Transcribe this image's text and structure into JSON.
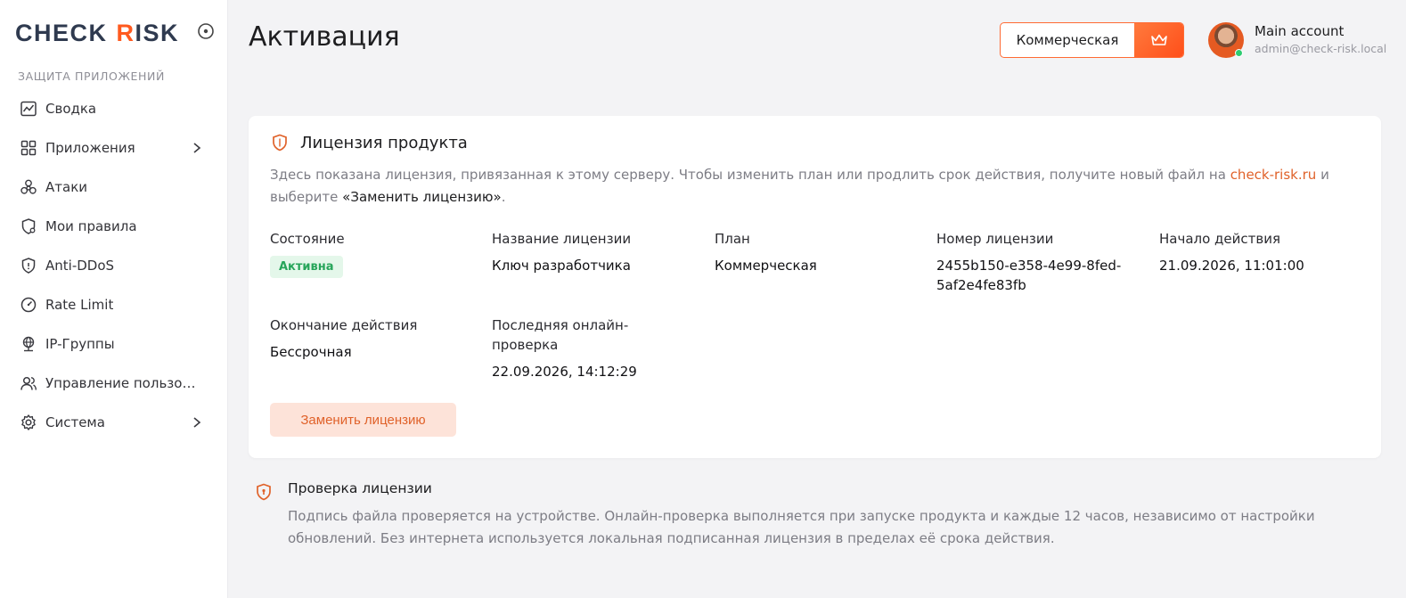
{
  "brand": {
    "part1": "CHECK",
    "letter_k": "R",
    "part2": "ISK",
    "accent": "#ff5a1f",
    "dark": "#2f3a4f"
  },
  "sidebar": {
    "section_title": "ЗАЩИТА ПРИЛОЖЕНИЙ",
    "items": [
      {
        "label": "Сводка",
        "icon": "chart-icon",
        "has_children": false
      },
      {
        "label": "Приложения",
        "icon": "grid-icon",
        "has_children": true
      },
      {
        "label": "Атаки",
        "icon": "biohazard-icon",
        "has_children": false
      },
      {
        "label": "Мои правила",
        "icon": "shield-gear-icon",
        "has_children": false
      },
      {
        "label": "Anti-DDoS",
        "icon": "shield-icon",
        "has_children": false
      },
      {
        "label": "Rate Limit",
        "icon": "gauge-icon",
        "has_children": false
      },
      {
        "label": "IP-Группы",
        "icon": "globe-network-icon",
        "has_children": false
      },
      {
        "label": "Управление пользов...",
        "icon": "users-icon",
        "has_children": false
      },
      {
        "label": "Система",
        "icon": "gear-icon",
        "has_children": true
      }
    ]
  },
  "header": {
    "title": "Активация",
    "plan_label": "Коммерческая",
    "account_name": "Main account",
    "account_email": "admin@check-risk.local"
  },
  "license": {
    "title": "Лицензия продукта",
    "desc_part1": "Здесь показана лицензия, привязанная к этому серверу. Чтобы изменить план или продлить срок действия, получите новый файл на ",
    "desc_link": "check-risk.ru",
    "desc_part2": " и выберите ",
    "desc_strong": "«Заменить лицензию»",
    "desc_part3": ".",
    "fields": {
      "status_label": "Состояние",
      "status_value": "Активна",
      "name_label": "Название лицензии",
      "name_value": "Ключ разработчика",
      "plan_label": "План",
      "plan_value": "Коммерческая",
      "number_label": "Номер лицензии",
      "number_value": "2455b150-e358-4e99-8fed-5af2e4fe83fb",
      "start_label": "Начало действия",
      "start_value": "21.09.2026, 11:01:00",
      "end_label": "Окончание действия",
      "end_value": "Бессрочная",
      "last_check_label": "Последняя онлайн-проверка",
      "last_check_value": "22.09.2026, 14:12:29"
    },
    "replace_button": "Заменить лицензию"
  },
  "verification": {
    "title": "Проверка лицензии",
    "text": "Подпись файла проверяется на устройстве. Онлайн-проверка выполняется при запуске продукта и каждые 12 часов, независимо от настройки обновлений. Без интернета используется локальная подписанная лицензия в пределах её срока действия."
  },
  "colors": {
    "accent": "#e0622a",
    "success_bg": "#e4f7ea",
    "success_text": "#27a55a",
    "button_bg": "#fde3d9"
  }
}
